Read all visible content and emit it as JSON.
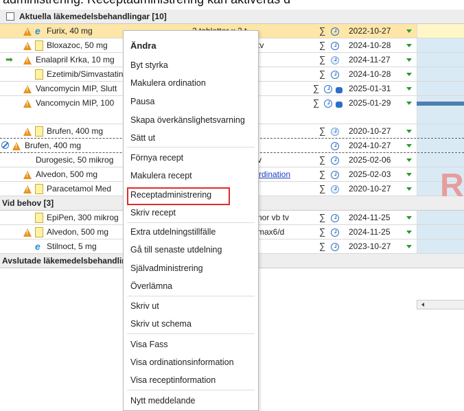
{
  "top_text": "administrering. Receptadministrering kan aktiveras d",
  "groups": {
    "current": "Aktuella läkemedelsbehandlingar [10]",
    "as_needed": "Vid behov [3]",
    "ended": "Avslutade läkemedelsbehandlingar"
  },
  "rows": [
    {
      "name": "Furix, 40 mg",
      "dose": "2 tabletter x 2 tv",
      "date": "2022-10-27"
    },
    {
      "name": "Bloxazoc, 50 mg",
      "dose": "tv",
      "date": "2024-10-28"
    },
    {
      "name": "Enalapril Krka, 10 mg",
      "dose": "",
      "date": "2024-11-27"
    },
    {
      "name": "Ezetimib/Simvastatin",
      "dose": "",
      "date": "2024-10-28"
    },
    {
      "name": "Vancomycin MIP, Slutt",
      "dose": "",
      "date": "2025-01-31"
    },
    {
      "name": "Vancomycin MIP, 100",
      "dose": "",
      "date": "2025-01-29"
    },
    {
      "name": "Brufen, 400 mg",
      "dose": "",
      "date": "2020-10-27"
    },
    {
      "name": "Brufen, 400 mg",
      "dose": "",
      "date": "2024-10-27"
    },
    {
      "name": "Durogesic, 50 mikrog",
      "dose": "v",
      "date": "2025-02-06"
    },
    {
      "name": "Alvedon, 500 mg",
      "dose": "rdination",
      "date": "2025-02-03"
    },
    {
      "name": "Paracetamol Med",
      "dose": "",
      "date": "2020-10-27"
    },
    {
      "name": "EpiPen, 300 mikrog",
      "dose": "nor vb tv",
      "date": "2024-11-25"
    },
    {
      "name": "Alvedon, 500 mg",
      "dose": "max6/d",
      "date": "2024-11-25"
    },
    {
      "name": "Stilnoct, 5 mg",
      "dose": "",
      "date": "2023-10-27"
    }
  ],
  "watermark": "R",
  "menu": {
    "items": [
      "Ändra",
      "Byt styrka",
      "Makulera ordination",
      "Pausa",
      "Skapa överkänslighetsvarning",
      "Sätt ut",
      "Förnya recept",
      "Makulera recept",
      "Receptadministrering",
      "Skriv recept",
      "Extra utdelningstillfälle",
      "Gå till senaste utdelning",
      "Självadministrering",
      "Överlämna",
      "Skriv ut",
      "Skriv ut schema",
      "Visa Fass",
      "Visa ordinationsinformation",
      "Visa receptinformation",
      "Nytt meddelande"
    ],
    "highlighted": "Receptadministrering"
  },
  "icons": {
    "warning": "warning-icon",
    "note": "note-icon",
    "eprescription": "e-icon",
    "sum": "sigma-icon",
    "clock": "clock-icon",
    "message": "message-icon",
    "arrow": "arrow-right-icon",
    "no-entry": "no-entry-icon"
  },
  "colors": {
    "selected_row": "#fde6a8",
    "highlight_border": "#e12b2b",
    "timeline": "#d9eaf5",
    "link": "#1a3fbf"
  },
  "glyphs": {
    "sigma": "∑",
    "arrow": "➡",
    "e": "e"
  }
}
